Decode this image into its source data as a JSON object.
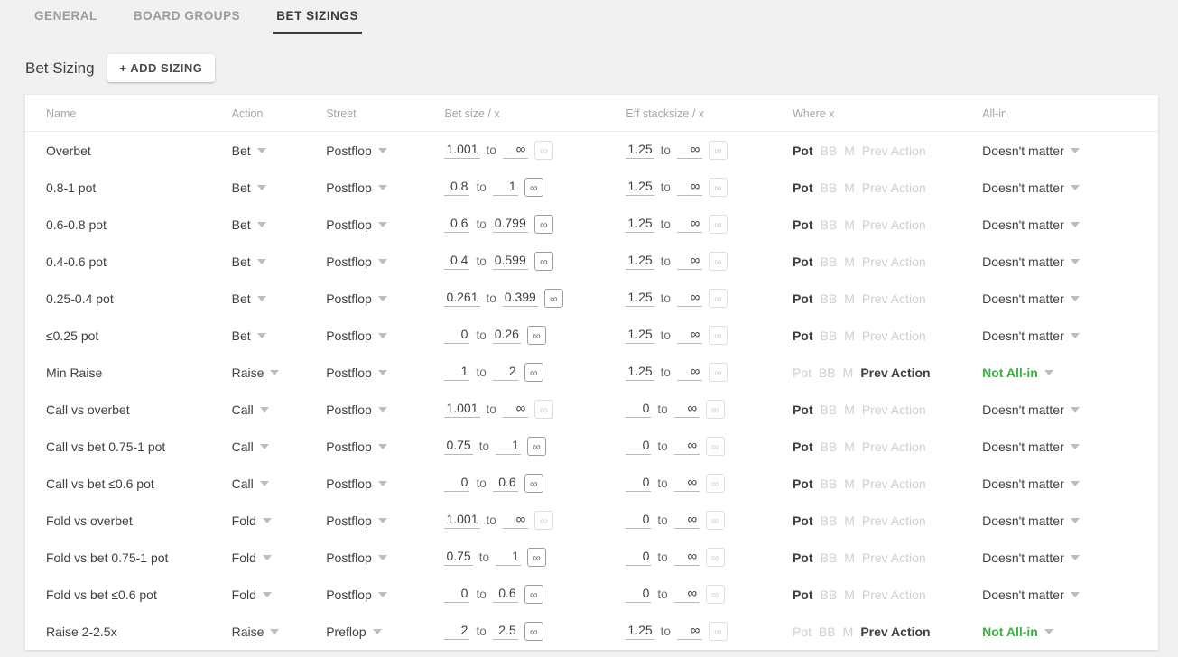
{
  "tabs": [
    {
      "label": "GENERAL",
      "active": false
    },
    {
      "label": "BOARD GROUPS",
      "active": false
    },
    {
      "label": "BET SIZINGS",
      "active": true
    }
  ],
  "section": {
    "title": "Bet Sizing",
    "add_button": "+ ADD SIZING"
  },
  "table": {
    "headers": {
      "name": "Name",
      "action": "Action",
      "street": "Street",
      "bet_size": "Bet size / x",
      "eff_stacksize": "Eff stacksize / x",
      "where": "Where x",
      "allin": "All-in"
    },
    "where_options": [
      "Pot",
      "BB",
      "M",
      "Prev Action"
    ],
    "infinity_symbol": "∞",
    "to_label": "to",
    "rows": [
      {
        "name": "Overbet",
        "action": "Bet",
        "street": "Postflop",
        "bet_from": "1.001",
        "bet_to": "∞",
        "bet_inf_active": false,
        "eff_from": "1.25",
        "eff_to": "∞",
        "eff_inf_active": false,
        "where": "Pot",
        "allin": "Doesn't matter",
        "allin_green": false
      },
      {
        "name": "0.8-1 pot",
        "action": "Bet",
        "street": "Postflop",
        "bet_from": "0.8",
        "bet_to": "1",
        "bet_inf_active": true,
        "eff_from": "1.25",
        "eff_to": "∞",
        "eff_inf_active": false,
        "where": "Pot",
        "allin": "Doesn't matter",
        "allin_green": false
      },
      {
        "name": "0.6-0.8 pot",
        "action": "Bet",
        "street": "Postflop",
        "bet_from": "0.6",
        "bet_to": "0.799",
        "bet_inf_active": true,
        "eff_from": "1.25",
        "eff_to": "∞",
        "eff_inf_active": false,
        "where": "Pot",
        "allin": "Doesn't matter",
        "allin_green": false
      },
      {
        "name": "0.4-0.6 pot",
        "action": "Bet",
        "street": "Postflop",
        "bet_from": "0.4",
        "bet_to": "0.599",
        "bet_inf_active": true,
        "eff_from": "1.25",
        "eff_to": "∞",
        "eff_inf_active": false,
        "where": "Pot",
        "allin": "Doesn't matter",
        "allin_green": false
      },
      {
        "name": "0.25-0.4 pot",
        "action": "Bet",
        "street": "Postflop",
        "bet_from": "0.261",
        "bet_to": "0.399",
        "bet_inf_active": true,
        "eff_from": "1.25",
        "eff_to": "∞",
        "eff_inf_active": false,
        "where": "Pot",
        "allin": "Doesn't matter",
        "allin_green": false
      },
      {
        "name": "≤0.25 pot",
        "action": "Bet",
        "street": "Postflop",
        "bet_from": "0",
        "bet_to": "0.26",
        "bet_inf_active": true,
        "eff_from": "1.25",
        "eff_to": "∞",
        "eff_inf_active": false,
        "where": "Pot",
        "allin": "Doesn't matter",
        "allin_green": false
      },
      {
        "name": "Min Raise",
        "action": "Raise",
        "street": "Postflop",
        "bet_from": "1",
        "bet_to": "2",
        "bet_inf_active": true,
        "eff_from": "1.25",
        "eff_to": "∞",
        "eff_inf_active": false,
        "where": "Prev Action",
        "allin": "Not All-in",
        "allin_green": true
      },
      {
        "name": "Call vs overbet",
        "action": "Call",
        "street": "Postflop",
        "bet_from": "1.001",
        "bet_to": "∞",
        "bet_inf_active": false,
        "eff_from": "0",
        "eff_to": "∞",
        "eff_inf_active": false,
        "where": "Pot",
        "allin": "Doesn't matter",
        "allin_green": false
      },
      {
        "name": "Call vs bet 0.75-1 pot",
        "action": "Call",
        "street": "Postflop",
        "bet_from": "0.75",
        "bet_to": "1",
        "bet_inf_active": true,
        "eff_from": "0",
        "eff_to": "∞",
        "eff_inf_active": false,
        "where": "Pot",
        "allin": "Doesn't matter",
        "allin_green": false
      },
      {
        "name": "Call vs bet ≤0.6 pot",
        "action": "Call",
        "street": "Postflop",
        "bet_from": "0",
        "bet_to": "0.6",
        "bet_inf_active": true,
        "eff_from": "0",
        "eff_to": "∞",
        "eff_inf_active": false,
        "where": "Pot",
        "allin": "Doesn't matter",
        "allin_green": false
      },
      {
        "name": "Fold vs overbet",
        "action": "Fold",
        "street": "Postflop",
        "bet_from": "1.001",
        "bet_to": "∞",
        "bet_inf_active": false,
        "eff_from": "0",
        "eff_to": "∞",
        "eff_inf_active": false,
        "where": "Pot",
        "allin": "Doesn't matter",
        "allin_green": false
      },
      {
        "name": "Fold vs bet 0.75-1 pot",
        "action": "Fold",
        "street": "Postflop",
        "bet_from": "0.75",
        "bet_to": "1",
        "bet_inf_active": true,
        "eff_from": "0",
        "eff_to": "∞",
        "eff_inf_active": false,
        "where": "Pot",
        "allin": "Doesn't matter",
        "allin_green": false
      },
      {
        "name": "Fold vs bet ≤0.6 pot",
        "action": "Fold",
        "street": "Postflop",
        "bet_from": "0",
        "bet_to": "0.6",
        "bet_inf_active": true,
        "eff_from": "0",
        "eff_to": "∞",
        "eff_inf_active": false,
        "where": "Pot",
        "allin": "Doesn't matter",
        "allin_green": false
      },
      {
        "name": "Raise 2-2.5x",
        "action": "Raise",
        "street": "Preflop",
        "bet_from": "2",
        "bet_to": "2.5",
        "bet_inf_active": true,
        "eff_from": "1.25",
        "eff_to": "∞",
        "eff_inf_active": false,
        "where": "Prev Action",
        "allin": "Not All-in",
        "allin_green": true
      }
    ]
  },
  "colors": {
    "accent_green": "#36b33b",
    "page_bg": "#f1f1f1",
    "card_bg": "#ffffff",
    "text": "#3f3f3f",
    "muted": "#a6a6a6"
  }
}
